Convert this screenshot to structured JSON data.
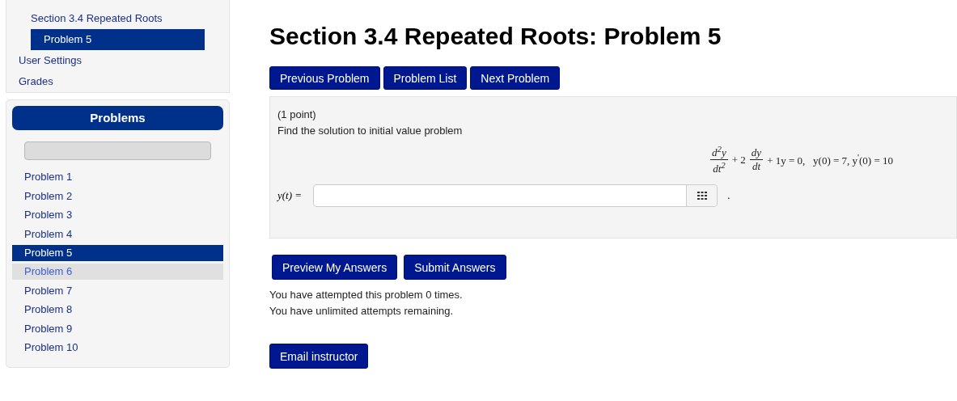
{
  "nav": {
    "items": [
      {
        "label": "Section 3.4 Repeated Roots",
        "kind": "sub",
        "selected": false
      },
      {
        "label": "Problem 5",
        "kind": "subsub",
        "selected": true
      },
      {
        "label": "User Settings",
        "kind": "top",
        "selected": false
      },
      {
        "label": "Grades",
        "kind": "top",
        "selected": false
      }
    ]
  },
  "problems_panel": {
    "title": "Problems",
    "progress": {
      "level": 0
    },
    "problems": [
      {
        "label": "Problem 1",
        "selected": false,
        "hovered": false
      },
      {
        "label": "Problem 2",
        "selected": false,
        "hovered": false
      },
      {
        "label": "Problem 3",
        "selected": false,
        "hovered": false
      },
      {
        "label": "Problem 4",
        "selected": false,
        "hovered": false
      },
      {
        "label": "Problem 5",
        "selected": true,
        "hovered": false
      },
      {
        "label": "Problem 6",
        "selected": false,
        "hovered": true
      },
      {
        "label": "Problem 7",
        "selected": false,
        "hovered": false
      },
      {
        "label": "Problem 8",
        "selected": false,
        "hovered": false
      },
      {
        "label": "Problem 9",
        "selected": false,
        "hovered": false
      },
      {
        "label": "Problem 10",
        "selected": false,
        "hovered": false
      }
    ]
  },
  "title": "Section 3.4 Repeated Roots: Problem 5",
  "nav_buttons": [
    "Previous Problem",
    "Problem List",
    "Next Problem"
  ],
  "problem": {
    "points": "(1 point)",
    "statement": "Find the solution to initial value problem",
    "equation": {
      "frac1_num": "d$^{2}$y",
      "frac1_den": "dt$^{2}$",
      "coef": "+ 2",
      "frac2_num": "dy",
      "frac2_den": "dt",
      "rest": "+ 1y = 0,   y(0) = 7, y$^{'}$(0) = 10"
    },
    "answer_label": "y(t) =",
    "answer_suffix": "."
  },
  "answer_buttons": [
    "Preview My Answers",
    "Submit Answers"
  ],
  "attempts": [
    "You have attempted this problem 0 times.",
    "You have unlimited attempts remaining."
  ],
  "email_button": "Email instructor"
}
